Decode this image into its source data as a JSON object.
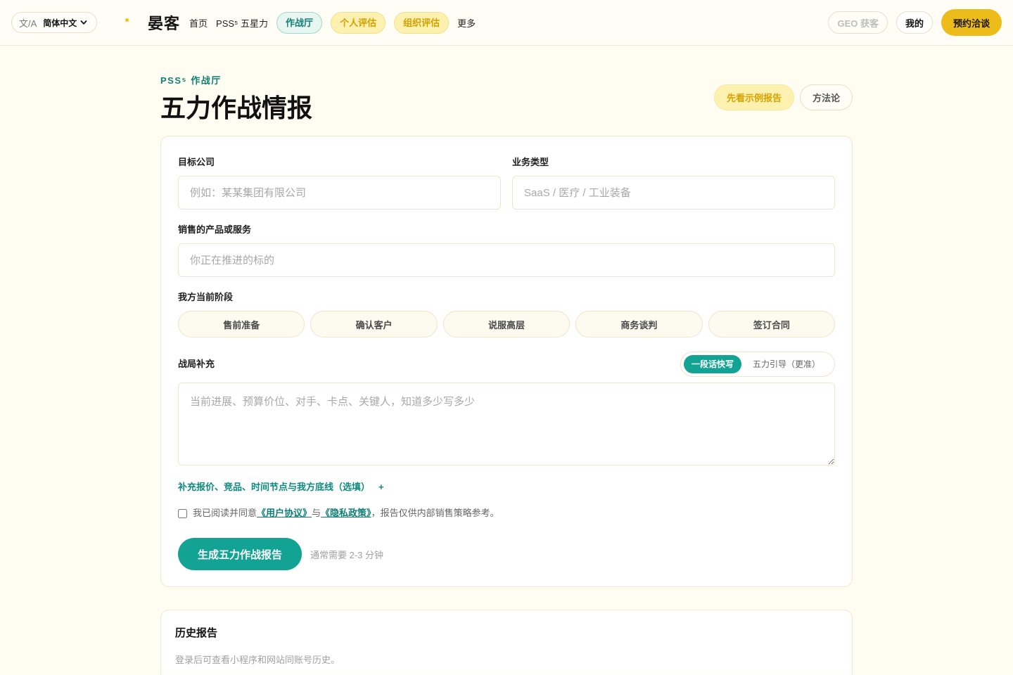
{
  "theme": {
    "accent": "#13a394",
    "accent_dark": "#0f7f74",
    "brand_yellow": "#ecbd1a",
    "soft_yellow": "#fdf1b0",
    "page_bg": "#fffcf2"
  },
  "header": {
    "language": {
      "glyph": "文/A",
      "current": "简体中文",
      "icon": "chevron-down-icon"
    },
    "brand": {
      "name": "晏客",
      "mark_icon": "brand-dot-icon"
    },
    "nav": [
      {
        "label": "首页"
      },
      {
        "label": "PSS⁵ 五星力"
      },
      {
        "label": "作战厅",
        "active": true
      },
      {
        "label": "个人评估"
      },
      {
        "label": "组织评估"
      },
      {
        "label": "更多"
      }
    ],
    "actions": {
      "geo": "GEO 获客",
      "mine": "我的",
      "contact": "预约洽谈"
    }
  },
  "hero": {
    "eyebrow": "PSS⁵ 作战厅",
    "title": "五力作战情报",
    "sample_button": "先看示例报告",
    "method_button": "方法论"
  },
  "form": {
    "company": {
      "label": "目标公司",
      "placeholder": "例如：某某集团有限公司",
      "value": ""
    },
    "business_type": {
      "label": "业务类型",
      "placeholder": "SaaS / 医疗 / 工业装备",
      "value": ""
    },
    "product": {
      "label": "销售的产品或服务",
      "placeholder": "你正在推进的标的",
      "value": ""
    },
    "stage": {
      "label": "我方当前阶段",
      "options": [
        "售前准备",
        "确认客户",
        "说服高层",
        "商务谈判",
        "签订合同"
      ],
      "selected_index": null
    },
    "context": {
      "label": "战局补充",
      "modes": [
        "一段话快写",
        "五力引导（更准）"
      ],
      "active_index": 0,
      "placeholder": "当前进展、预算价位、对手、卡点、关键人，知道多少写多少",
      "value": ""
    },
    "extra_toggle": {
      "label": "补充报价、竞品、时间节点与我方底线（选填）",
      "icon": "+"
    },
    "agreement": {
      "checked": false,
      "prefix": "我已阅读并同意",
      "terms": "《用户协议》",
      "joiner": "与",
      "privacy": "《隐私政策》",
      "suffix": "，报告仅供内部销售策略参考。"
    },
    "submit": {
      "label": "生成五力作战报告",
      "hint": "通常需要 2-3 分钟"
    }
  },
  "history": {
    "title": "历史报告",
    "empty_text": "登录后可查看小程序和网站同账号历史。"
  }
}
